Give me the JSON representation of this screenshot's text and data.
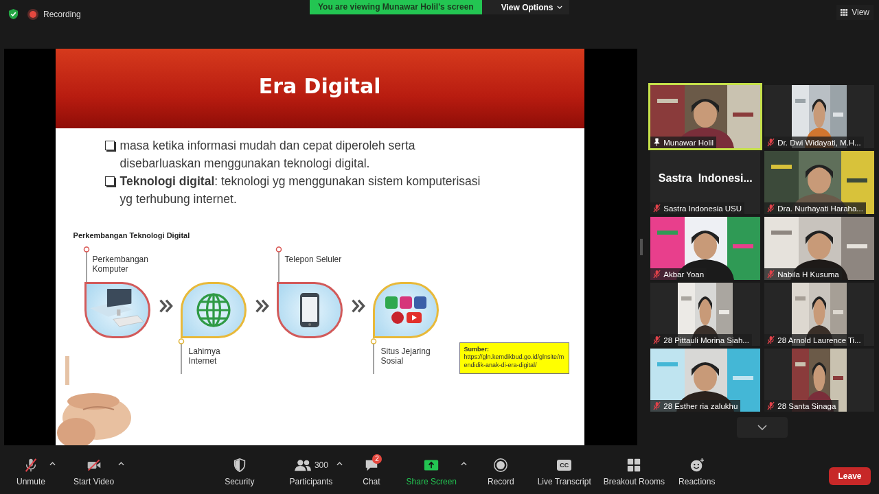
{
  "top_bar": {
    "recording_label": "Recording",
    "banner": "You are viewing Munawar Holil's screen",
    "view_options": "View Options",
    "view_button": "View"
  },
  "slide": {
    "title": "Era Digital",
    "bullets": [
      {
        "lines": [
          "masa ketika informasi mudah dan cepat diperoleh serta",
          "disebarluaskan menggunakan teknologi digital."
        ]
      },
      {
        "lines": [
          "**Teknologi digital**: teknologi yg menggunakan sistem komputerisasi",
          "yg terhubung internet."
        ]
      }
    ],
    "diagram_title": "Perkembangan Teknologi Digital",
    "steps": [
      {
        "kind": "computer",
        "label": "Perkembangan Komputer",
        "label_above": true
      },
      {
        "kind": "globe",
        "label": "Lahirnya Internet",
        "label_above": false
      },
      {
        "kind": "phone",
        "label": "Telepon Seluler",
        "label_above": true
      },
      {
        "kind": "social",
        "label": "Situs Jejaring Sosial",
        "label_above": false
      }
    ],
    "source_label": "Sumber:",
    "source_text": "https://gln.kemdikbud.go.id/glnsite/mendidik-anak-di-era-digital/"
  },
  "participants": [
    {
      "name": "Munawar Holil",
      "kind": "video",
      "muted": false,
      "active": true
    },
    {
      "name": "Dr. Dwi Widayati, M.H...",
      "kind": "portrait",
      "muted": true,
      "active": false
    },
    {
      "name": "Sastra Indonesia USU",
      "kind": "name",
      "display": "Sastra  Indonesi...",
      "muted": true,
      "active": false
    },
    {
      "name": "Dra. Nurhayati Haraha...",
      "kind": "video",
      "muted": true,
      "active": false
    },
    {
      "name": "Akbar Yoan",
      "kind": "video",
      "muted": true,
      "active": false
    },
    {
      "name": "Nabila H Kusuma",
      "kind": "video",
      "muted": true,
      "active": false
    },
    {
      "name": "28 Pittauli Morina Siah...",
      "kind": "portrait",
      "muted": true,
      "active": false
    },
    {
      "name": "28 Arnold Laurence Ti...",
      "kind": "portrait",
      "muted": true,
      "active": false
    },
    {
      "name": "28 Esther ria zalukhu",
      "kind": "video",
      "muted": true,
      "active": false
    },
    {
      "name": "28 Santa Sinaga",
      "kind": "portrait",
      "muted": true,
      "active": false
    }
  ],
  "toolbar": [
    {
      "kind": "audio",
      "label": "Unmute",
      "off": true,
      "caret": true
    },
    {
      "kind": "video",
      "label": "Start Video",
      "off": true,
      "caret": true
    },
    {
      "kind": "security",
      "label": "Security"
    },
    {
      "kind": "participants",
      "label": "Participants",
      "count": "300",
      "caret": true
    },
    {
      "kind": "chat",
      "label": "Chat",
      "badge": "2"
    },
    {
      "kind": "share",
      "label": "Share Screen",
      "caret": true
    },
    {
      "kind": "record",
      "label": "Record"
    },
    {
      "kind": "transcript",
      "label": "Live Transcript",
      "icon_text": "CC"
    },
    {
      "kind": "breakout",
      "label": "Breakout Rooms"
    },
    {
      "kind": "reactions",
      "label": "Reactions"
    }
  ],
  "leave_button": "Leave"
}
